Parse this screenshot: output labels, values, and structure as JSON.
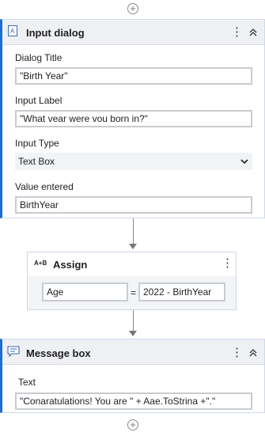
{
  "input_dialog": {
    "title": "Input dialog",
    "icon": "input-dialog-icon",
    "fields": {
      "dialog_title_label": "Dialog Title",
      "dialog_title_value": "\"Birth Year\"",
      "input_label_label": "Input Label",
      "input_label_value": "\"What vear were vou born in?\"",
      "input_type_label": "Input Type",
      "input_type_value": "Text Box",
      "value_entered_label": "Value entered",
      "value_entered_value": "BirthYear"
    }
  },
  "assign": {
    "title": "Assign",
    "icon_text": "A+B",
    "left": "Age",
    "operator": "=",
    "right": "2022 - BirthYear"
  },
  "message_box": {
    "title": "Message box",
    "icon": "message-icon",
    "text_label": "Text",
    "text_value": "\"Conaratulations! You are \" + Aae.ToStrina +\".\""
  },
  "add_symbol": "+",
  "colors": {
    "accent": "#1a6fcf",
    "header_bg": "#eef0f3",
    "field_border": "#c8ccd1"
  }
}
